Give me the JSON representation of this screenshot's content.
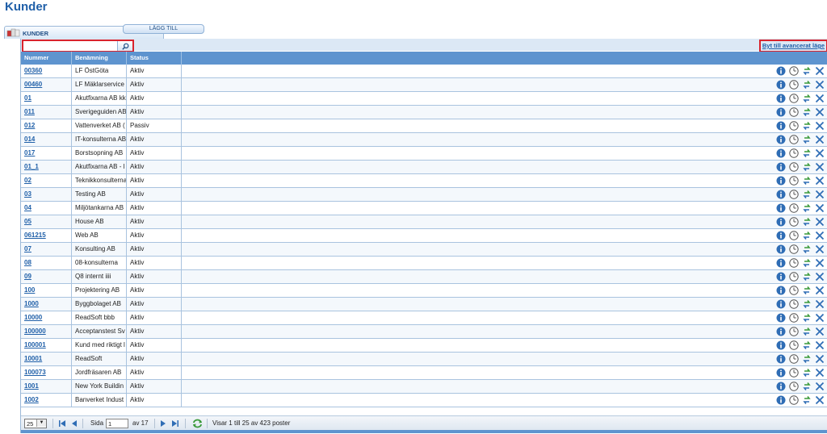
{
  "page": {
    "title": "Kunder"
  },
  "tabs": {
    "kunder_label": "KUNDER",
    "add_label": "LÄGG TILL"
  },
  "search": {
    "value": "",
    "placeholder": ""
  },
  "advanced_link": "Byt till avancerat läge",
  "columns": [
    "Nummer",
    "Benämning",
    "Status"
  ],
  "rows": [
    {
      "number": "00360",
      "name": "LF ÖstGöta",
      "status": "Aktiv"
    },
    {
      "number": "00460",
      "name": "LF Mäklarservice",
      "status": "Aktiv"
    },
    {
      "number": "01",
      "name": "Akutfixarna AB kk",
      "status": "Aktiv"
    },
    {
      "number": "011",
      "name": "Sverigeguiden AB",
      "status": "Aktiv"
    },
    {
      "number": "012",
      "name": "Vattenverket AB (",
      "status": "Passiv"
    },
    {
      "number": "014",
      "name": "IT-konsulterna AB",
      "status": "Aktiv"
    },
    {
      "number": "017",
      "name": "Borstsopning AB",
      "status": "Aktiv"
    },
    {
      "number": "01_1",
      "name": "Akutfixarna AB - l",
      "status": "Aktiv"
    },
    {
      "number": "02",
      "name": "Teknikkonsulterna",
      "status": "Aktiv"
    },
    {
      "number": "03",
      "name": "Testing AB",
      "status": "Aktiv"
    },
    {
      "number": "04",
      "name": "Miljötankarna AB",
      "status": "Aktiv"
    },
    {
      "number": "05",
      "name": "House AB",
      "status": "Aktiv"
    },
    {
      "number": "061215",
      "name": "Web AB",
      "status": "Aktiv"
    },
    {
      "number": "07",
      "name": "Konsulting AB",
      "status": "Aktiv"
    },
    {
      "number": "08",
      "name": "08-konsulterna",
      "status": "Aktiv"
    },
    {
      "number": "09",
      "name": "Q8 internt iiii",
      "status": "Aktiv"
    },
    {
      "number": "100",
      "name": "Projektering AB",
      "status": "Aktiv"
    },
    {
      "number": "1000",
      "name": "Byggbolaget AB",
      "status": "Aktiv"
    },
    {
      "number": "10000",
      "name": "ReadSoft bbb",
      "status": "Aktiv"
    },
    {
      "number": "100000",
      "name": "Acceptanstest Sv",
      "status": "Aktiv"
    },
    {
      "number": "100001",
      "name": "Kund med riktigt l",
      "status": "Aktiv"
    },
    {
      "number": "10001",
      "name": "ReadSoft",
      "status": "Aktiv"
    },
    {
      "number": "100073",
      "name": "Jordfräsaren AB",
      "status": "Aktiv"
    },
    {
      "number": "1001",
      "name": "New York Buildin",
      "status": "Aktiv"
    },
    {
      "number": "1002",
      "name": "Banverket Indust",
      "status": "Aktiv"
    }
  ],
  "row_actions": [
    "info-icon",
    "history-icon",
    "convert-icon",
    "delete-icon"
  ],
  "pager": {
    "page_size": "25",
    "page_label": "Sida",
    "page_value": "1",
    "of_label": "av 17",
    "records_text": "Visar 1 till 25 av 423 poster"
  },
  "colors": {
    "brand": "#1f5fa8",
    "header_bg": "#5e94cf",
    "highlight": "#d9232d",
    "action_blue": "#2f6db5",
    "action_green": "#3a9a3a"
  }
}
